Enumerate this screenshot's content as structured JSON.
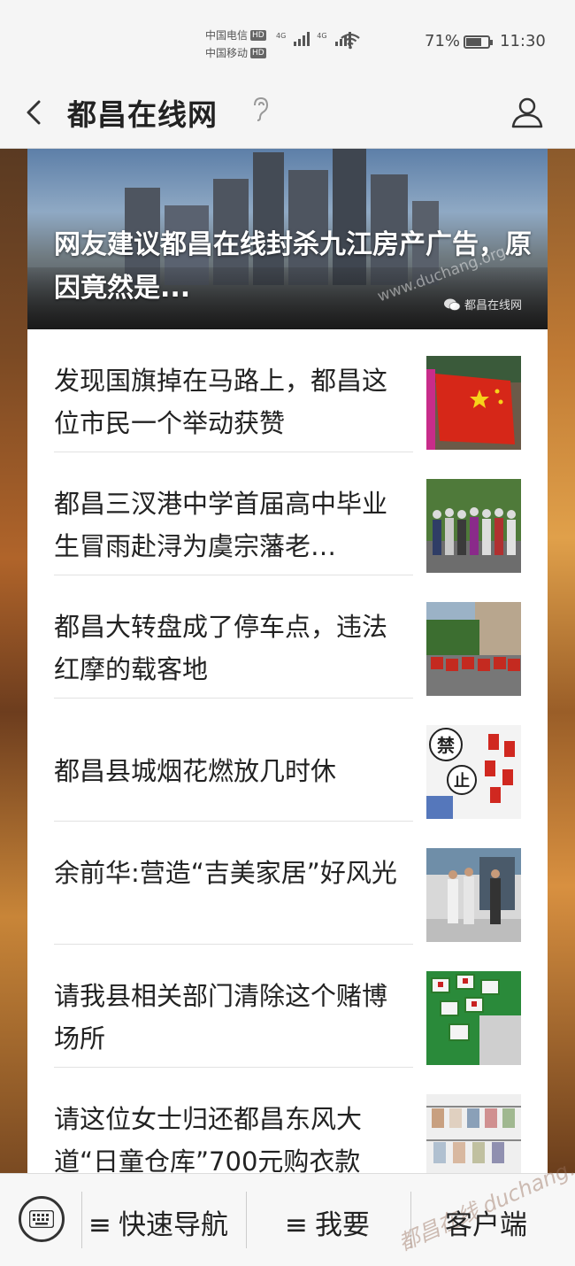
{
  "status_bar": {
    "carrier_1": "中国电信",
    "carrier_2": "中国移动",
    "hd": "HD",
    "network": "4G",
    "battery_percent": "71%",
    "battery_level": 0.71,
    "time": "11:30"
  },
  "nav": {
    "title": "都昌在线网"
  },
  "banner": {
    "title": "网友建议都昌在线封杀九江房产广告，原因竟然是...",
    "watermark_url": "www.duchang.org",
    "source": "都昌在线网"
  },
  "articles": [
    {
      "title": "发现国旗掉在马路上，都昌这位市民一个举动获赞",
      "thumb": "flag"
    },
    {
      "title": "都昌三汊港中学首届高中毕业生冒雨赴浔为虞宗藩老…",
      "thumb": "group"
    },
    {
      "title": "都昌大转盘成了停车点，违法红摩的载客地",
      "thumb": "street"
    },
    {
      "title": "都昌县城烟花燃放几时休",
      "thumb": "ban"
    },
    {
      "title": "余前华:营造“吉美家居”好风光",
      "thumb": "store"
    },
    {
      "title": "请我县相关部门清除这个赌博场所",
      "thumb": "mahjong"
    },
    {
      "title": "请这位女士归还都昌东风大道“日童仓库”700元购衣款",
      "thumb": "clothes"
    }
  ],
  "thumb_badges": {
    "ban_top": "禁",
    "ban_bottom": "止"
  },
  "bottom_menu": {
    "nav_label": "快速导航",
    "want_label": "我要",
    "client_label": "客户端",
    "menu_glyph": "≡",
    "watermark": "都昌在线 duchang.org"
  },
  "colors": {
    "accent_text": "#222222",
    "flag_red": "#d62718"
  }
}
